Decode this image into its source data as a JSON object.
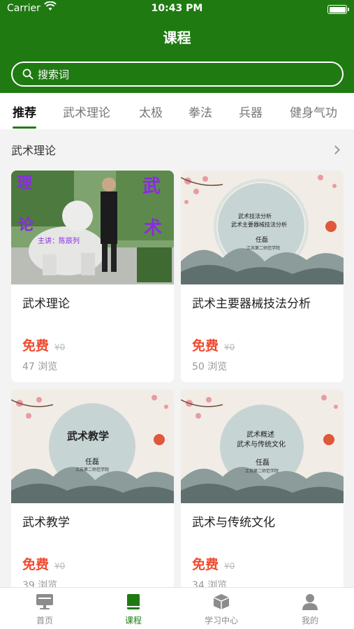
{
  "status_bar": {
    "carrier": "Carrier",
    "time": "10:43 PM"
  },
  "header": {
    "title": "课程",
    "search_placeholder": "搜索词"
  },
  "tabs": [
    {
      "label": "推荐",
      "active": true
    },
    {
      "label": "武术理论",
      "active": false
    },
    {
      "label": "太极",
      "active": false
    },
    {
      "label": "拳法",
      "active": false
    },
    {
      "label": "兵器",
      "active": false
    },
    {
      "label": "健身气功",
      "active": false
    }
  ],
  "section": {
    "title": "武术理论"
  },
  "courses": [
    {
      "name": "武术理论",
      "price": "免费",
      "original_price": "¥0",
      "views": "47 浏览",
      "thumb_text": {
        "left_top": "理",
        "left_mid": "论",
        "right_top": "武",
        "right_mid": "术",
        "lecturer": "主讲：陈辰列"
      }
    },
    {
      "name": "武术主要器械技法分析",
      "price": "免费",
      "original_price": "¥0",
      "views": "50 浏览",
      "thumb_text": {
        "line1": "武术技法分析",
        "line2": "武术主要器械技法分析",
        "author": "任磊",
        "school": "江苏第二师范学院"
      }
    },
    {
      "name": "武术教学",
      "price": "免费",
      "original_price": "¥0",
      "views": "39 浏览",
      "thumb_text": {
        "line1": "武术教学",
        "author": "任磊",
        "school": "江苏第二师范学院"
      }
    },
    {
      "name": "武术与传统文化",
      "price": "免费",
      "original_price": "¥0",
      "views": "34 浏览",
      "thumb_text": {
        "line1": "武术概述",
        "line2": "武术与传统文化",
        "author": "任磊",
        "school": "江苏第二师范学院"
      }
    }
  ],
  "tabbar": [
    {
      "label": "首页",
      "icon": "monitor-icon",
      "active": false
    },
    {
      "label": "课程",
      "icon": "book-icon",
      "active": true
    },
    {
      "label": "学习中心",
      "icon": "cube-icon",
      "active": false
    },
    {
      "label": "我的",
      "icon": "person-icon",
      "active": false
    }
  ],
  "colors": {
    "brand": "#1f7a12",
    "price": "#f04a2e"
  }
}
